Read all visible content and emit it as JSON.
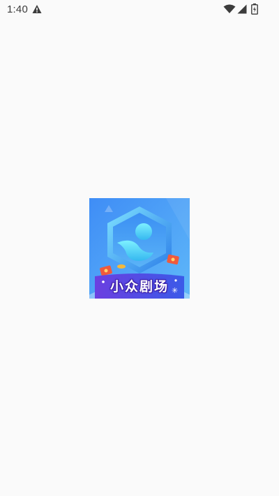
{
  "status_bar": {
    "time": "1:40",
    "icons": [
      "warning-icon",
      "wifi-icon",
      "signal-icon",
      "battery-icon"
    ]
  },
  "splash": {
    "app_name": "小众剧场",
    "logo_icon": "hexagon-person-logo",
    "colors": {
      "background": "#fafafa",
      "logo_blue": "#4f8ef7",
      "logo_purple": "#5a3fd8",
      "accent_red": "#f05a3c"
    }
  }
}
